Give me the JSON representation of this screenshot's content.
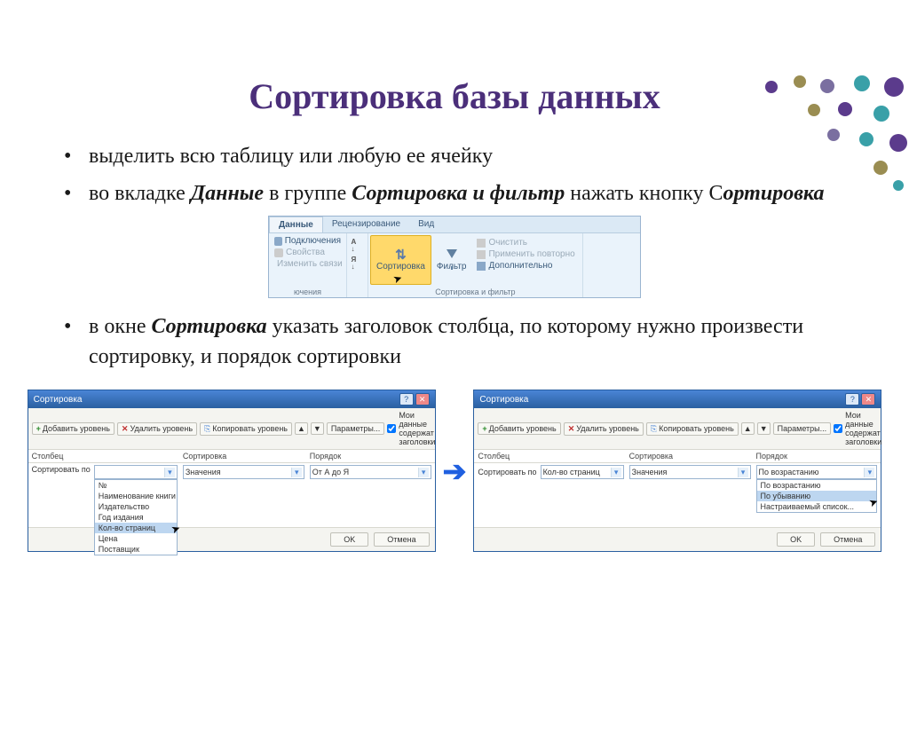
{
  "title": "Сортировка базы данных",
  "bullets": [
    {
      "text": "выделить всю таблицу или любую ее ячейку"
    },
    {
      "parts": [
        {
          "t": "во вкладке "
        },
        {
          "t": "Данные",
          "bi": true
        },
        {
          "t": " в группе "
        },
        {
          "t": "Сортировка и фильтр",
          "bi": true
        },
        {
          "t": "  нажать кнопку С"
        },
        {
          "t": "ортировка",
          "bi": true
        }
      ]
    },
    {
      "parts": [
        {
          "t": "в окне "
        },
        {
          "t": "Сортировка",
          "bi": true
        },
        {
          "t": " указать заголовок столбца, по которому нужно произвести сортировку, и порядок сортировки"
        }
      ]
    }
  ],
  "ribbon": {
    "tabs": [
      "Данные",
      "Рецензирование",
      "Вид"
    ],
    "active_tab": 0,
    "group_conn": {
      "items": [
        "Подключения",
        "Свойства",
        "Изменить связи"
      ],
      "label": "ючения"
    },
    "group_sort": {
      "sort_label": "Сортировка",
      "filter_label": "Фильтр",
      "group_label": "Сортировка и фильтр",
      "side_items": [
        "Очистить",
        "Применить повторно",
        "Дополнительно"
      ]
    }
  },
  "dialog_common": {
    "title": "Сортировка",
    "btn_add": "Добавить уровень",
    "btn_del": "Удалить уровень",
    "btn_copy": "Копировать уровень",
    "btn_params": "Параметры...",
    "checkbox": "Мои данные содержат заголовки",
    "col_headers": [
      "Столбец",
      "Сортировка",
      "Порядок"
    ],
    "sortby_label": "Сортировать по",
    "sort_value": "Значения",
    "ok": "OK",
    "cancel": "Отмена"
  },
  "dialog_left": {
    "column_value": "",
    "order_value": "От А до Я",
    "dropdown_items": [
      "№",
      "Наименование книги",
      "Издательство",
      "Год издания",
      "Кол-во страниц",
      "Цена",
      "Поставщик"
    ],
    "dropdown_selected_index": 4
  },
  "dialog_right": {
    "column_value": "Кол-во страниц",
    "order_value": "По возрастанию",
    "order_dropdown": [
      "По возрастанию",
      "По убыванию",
      "Настраиваемый список..."
    ],
    "order_selected_index": 1
  }
}
